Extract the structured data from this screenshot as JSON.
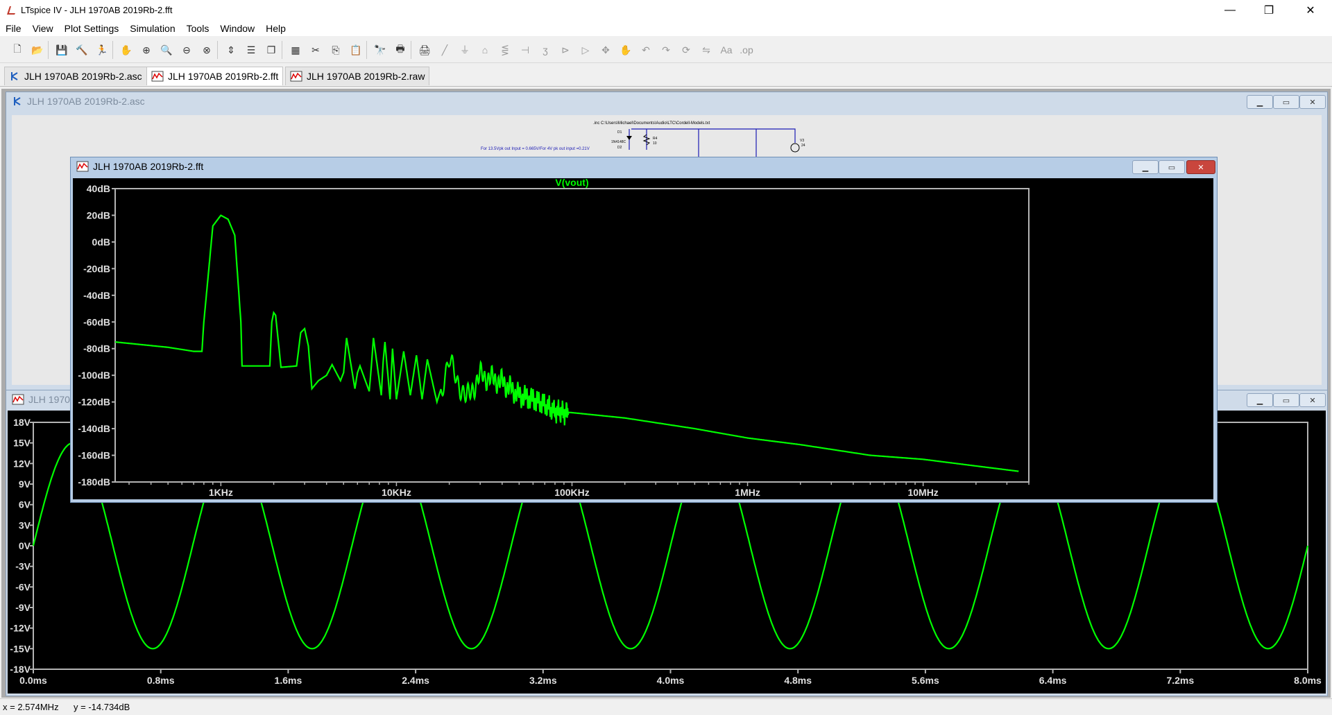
{
  "window": {
    "title": "LTspice IV - JLH 1970AB 2019Rb-2.fft",
    "controls": {
      "minimize": "—",
      "restore": "❐",
      "close": "✕"
    }
  },
  "menu": [
    "File",
    "View",
    "Plot Settings",
    "Simulation",
    "Tools",
    "Window",
    "Help"
  ],
  "toolbar_icons": [
    "new-schematic-icon",
    "open-icon",
    "save-icon",
    "control-panel-icon",
    "run-icon",
    "halt-icon",
    "zoom-in-icon",
    "zoom-area-icon",
    "zoom-out-icon",
    "zoom-fit-icon",
    "autorange-icon",
    "tile-horizontal-icon",
    "cascade-icon",
    "tile-icon",
    "cut-icon",
    "copy-icon",
    "paste-icon",
    "find-icon",
    "print-preview-icon",
    "print-icon",
    "wire-icon",
    "ground-icon",
    "label-icon",
    "resistor-icon",
    "capacitor-icon",
    "inductor-icon",
    "diode-icon",
    "component-icon",
    "move-icon",
    "drag-icon",
    "undo-icon",
    "redo-icon",
    "rotate-icon",
    "mirror-icon",
    "text-icon",
    "spice-directive-icon"
  ],
  "tabs": [
    {
      "label": "JLH 1970AB 2019Rb-2.asc",
      "icon": "schematic-icon"
    },
    {
      "label": "JLH 1970AB 2019Rb-2.fft",
      "icon": "waveform-icon"
    },
    {
      "label": "JLH 1970AB 2019Rb-2.raw",
      "icon": "waveform-icon"
    }
  ],
  "windows": {
    "schematic": {
      "title": "JLH 1970AB 2019Rb-2.asc",
      "directive": ".inc C:\\Users\\Michael\\Documents\\Audio\\LTC\\Cordell-Models.txt",
      "note": "For 13.5Vpk out Input = 0.665V/For 4V pk out input =0.21V",
      "parts": [
        "D1",
        "1N4148C",
        "D2",
        "R4",
        "10",
        "V3",
        "24"
      ]
    },
    "transient": {
      "title": "JLH 1970AB 2019Rb-2.raw"
    },
    "fft": {
      "title": "JLH 1970AB 2019Rb-2.fft"
    }
  },
  "fft_plot": {
    "trace": "V(vout)",
    "y_ticks": [
      "40dB",
      "20dB",
      "0dB",
      "-20dB",
      "-40dB",
      "-60dB",
      "-80dB",
      "-100dB",
      "-120dB",
      "-140dB",
      "-160dB",
      "-180dB"
    ],
    "x_ticks": [
      "1KHz",
      "10KHz",
      "100KHz",
      "1MHz",
      "10MHz"
    ],
    "trace_color": "#00ff00",
    "grid_color": "#b4b4b4"
  },
  "transient_plot": {
    "y_ticks": [
      "18V",
      "15V",
      "12V",
      "9V",
      "6V",
      "3V",
      "0V",
      "-3V",
      "-6V",
      "-9V",
      "-12V",
      "-15V",
      "-18V"
    ],
    "x_ticks": [
      "0.0ms",
      "0.8ms",
      "1.6ms",
      "2.4ms",
      "3.2ms",
      "4.0ms",
      "4.8ms",
      "5.6ms",
      "6.4ms",
      "7.2ms",
      "8.0ms"
    ]
  },
  "chart_data": [
    {
      "type": "line",
      "title": "V(vout)",
      "xscale": "log",
      "xlim": [
        250,
        40000000
      ],
      "ylim": [
        -180,
        40
      ],
      "x_unit": "Hz",
      "y_unit": "dB",
      "series": [
        {
          "name": "V(vout)",
          "x": [
            250,
            500,
            700,
            780,
            800,
            900,
            1000,
            1100,
            1200,
            1300,
            1320,
            1900,
            1950,
            2000,
            2050,
            2100,
            2200,
            2700,
            2850,
            3000,
            3150,
            3300,
            3600,
            4000,
            4300,
            4800,
            5000,
            5200,
            5800,
            6000,
            6200,
            7000,
            7200,
            7400,
            8200,
            8400,
            8600,
            9200,
            9500,
            10000,
            11000,
            12000,
            13000,
            14000,
            15000,
            17000,
            20000,
            25000,
            30000,
            40000,
            50000,
            60000,
            70000,
            80000,
            100000,
            200000,
            500000,
            1000000,
            2000000,
            5000000,
            10000000,
            20000000,
            35000000
          ],
          "y": [
            -75,
            -79,
            -82,
            -82,
            -60,
            12,
            20,
            17,
            5,
            -60,
            -93,
            -93,
            -60,
            -53,
            -55,
            -68,
            -94,
            -93,
            -68,
            -65,
            -78,
            -110,
            -104,
            -100,
            -92,
            -104,
            -98,
            -72,
            -110,
            -98,
            -93,
            -112,
            -93,
            -72,
            -115,
            -90,
            -75,
            -118,
            -80,
            -118,
            -82,
            -115,
            -85,
            -118,
            -88,
            -120,
            -90,
            -118,
            -100,
            -105,
            -115,
            -118,
            -122,
            -127,
            -128,
            -132,
            -140,
            -147,
            -152,
            -160,
            -163,
            -168,
            -172
          ]
        }
      ]
    },
    {
      "type": "line",
      "xlim": [
        0,
        8
      ],
      "ylim": [
        -18,
        18
      ],
      "x_unit": "ms",
      "y_unit": "V",
      "series": [
        {
          "name": "",
          "period_ms": 1.0,
          "amplitude_v": 15,
          "note_visible": "sine"
        }
      ]
    }
  ],
  "status": {
    "x": "x = 2.574MHz",
    "y": "y = -14.734dB"
  }
}
